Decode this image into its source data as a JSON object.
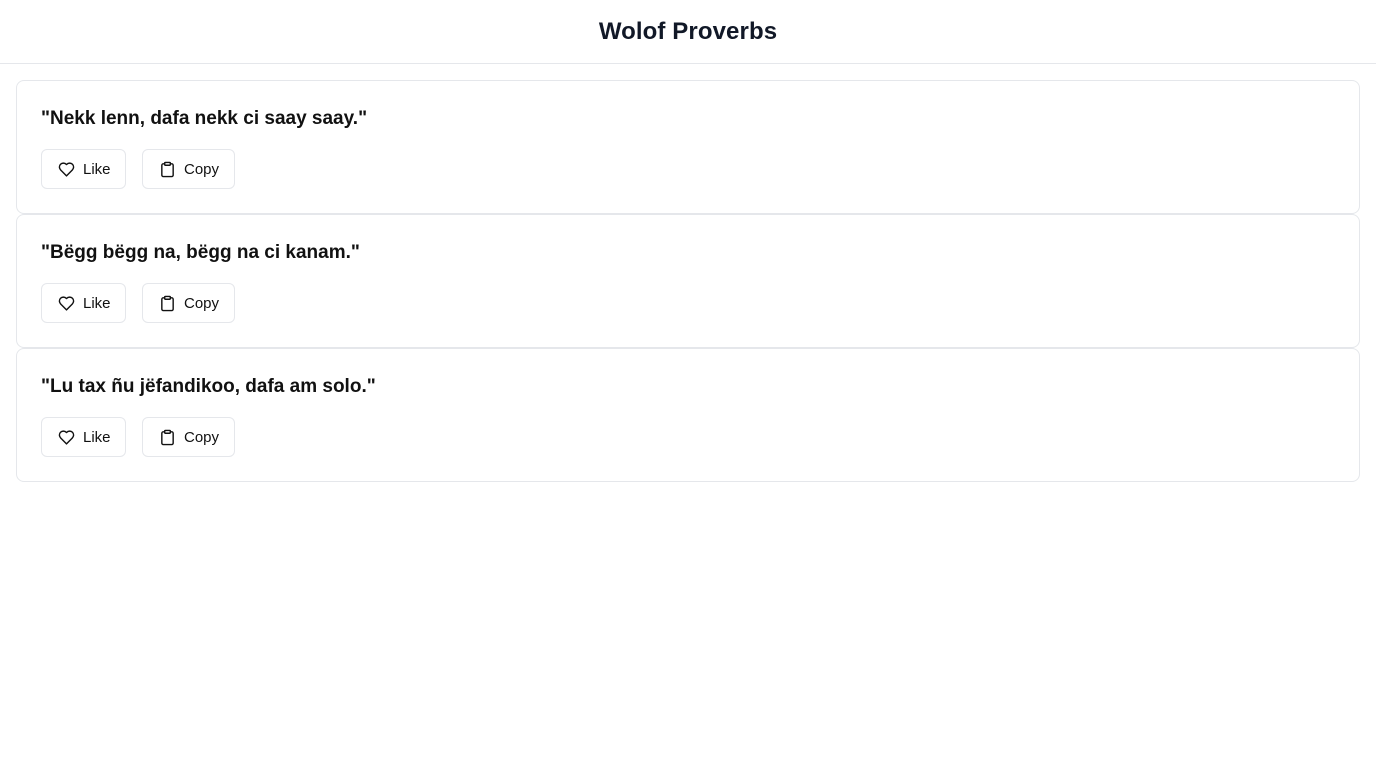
{
  "header": {
    "title": "Wolof Proverbs"
  },
  "proverbs": [
    {
      "text": "\"Nekk lenn, dafa nekk ci saay saay.\"",
      "like_label": "Like",
      "copy_label": "Copy"
    },
    {
      "text": "\"Bëgg bëgg na, bëgg na ci kanam.\"",
      "like_label": "Like",
      "copy_label": "Copy"
    },
    {
      "text": "\"Lu tax ñu jëfandikoo, dafa am solo.\"",
      "like_label": "Like",
      "copy_label": "Copy"
    }
  ],
  "icons": {
    "like": "heart-icon",
    "copy": "clipboard-icon"
  }
}
